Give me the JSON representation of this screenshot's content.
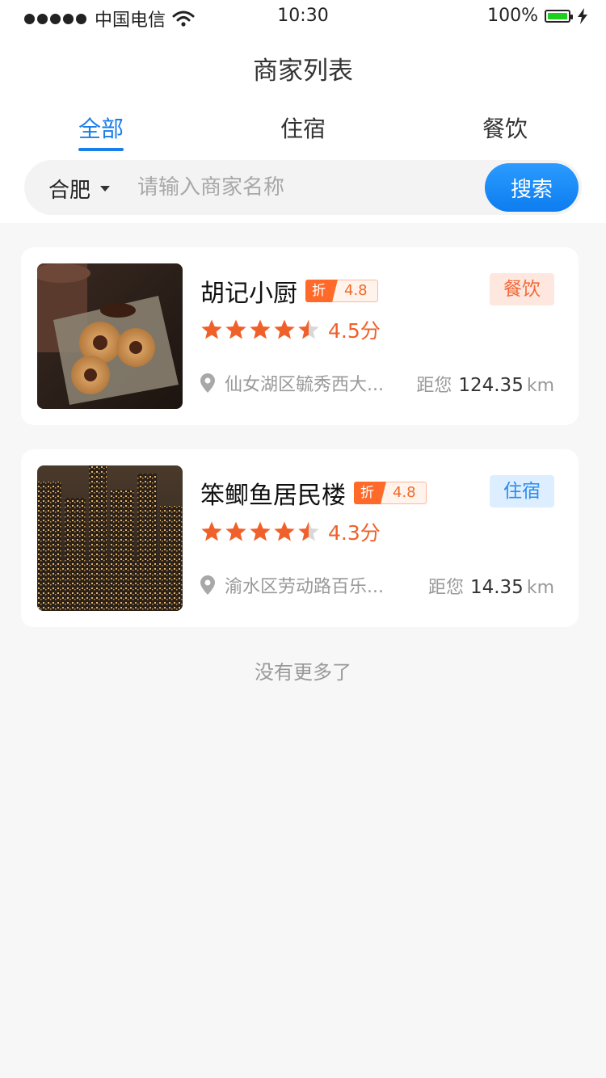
{
  "status_bar": {
    "carrier": "中国电信",
    "time": "10:30",
    "battery": "100%"
  },
  "nav": {
    "title": "商家列表"
  },
  "tabs": [
    {
      "label": "全部",
      "active": true
    },
    {
      "label": "住宿",
      "active": false
    },
    {
      "label": "餐饮",
      "active": false
    }
  ],
  "search": {
    "city": "合肥",
    "placeholder": "请输入商家名称",
    "button_label": "搜索"
  },
  "merchants": [
    {
      "name": "胡记小厨",
      "discount_tag": "折",
      "discount_score": "4.8",
      "category": "餐饮",
      "rating_stars": 4.5,
      "score_text": "4.5分",
      "address": "仙女湖区毓秀西大...",
      "distance_prefix": "距您",
      "distance": "124.35",
      "distance_unit": "km"
    },
    {
      "name": "笨鲫鱼居民楼",
      "discount_tag": "折",
      "discount_score": "4.8",
      "category": "住宿",
      "rating_stars": 4.5,
      "score_text": "4.3分",
      "address": "渝水区劳动路百乐...",
      "distance_prefix": "距您",
      "distance": "14.35",
      "distance_unit": "km"
    }
  ],
  "footer": {
    "end_text": "没有更多了"
  },
  "colors": {
    "accent": "#1a7ee8",
    "star": "#f0602a",
    "discount": "#ff6a2a"
  }
}
